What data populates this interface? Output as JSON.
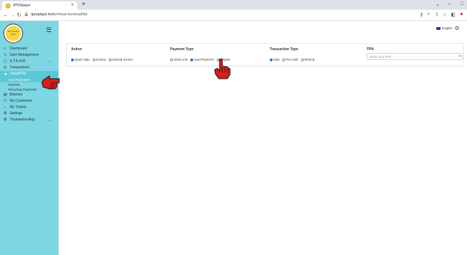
{
  "browser": {
    "tab_title": "iPOSpays",
    "new_tab": "+",
    "close_tab": "×",
    "url_host": "iposplays.tech",
    "url_path": "/virtual-terminal/list",
    "window_controls": [
      "⌄",
      "–",
      "□"
    ],
    "toolbar_icons": [
      "key-icon",
      "zoom-icon",
      "share-icon",
      "star-icon",
      "sidebar-icon"
    ]
  },
  "sidebar": {
    "logo_text": "Dve Lincoln Store",
    "menu": [
      {
        "label": "Dashboard",
        "icon": "⌂",
        "icon_name": "dashboard-icon",
        "chevron": false,
        "active": false
      },
      {
        "label": "User Management",
        "icon": "⚇",
        "icon_name": "users-icon",
        "chevron": false,
        "active": false
      },
      {
        "label": "S.T.E.A.M",
        "icon": "▢",
        "icon_name": "steam-icon",
        "chevron": true,
        "active": false
      },
      {
        "label": "Transactions",
        "icon": "◎",
        "icon_name": "transactions-icon",
        "chevron": false,
        "active": false
      },
      {
        "label": "CloudPOS",
        "icon": "☁",
        "icon_name": "cloud-icon",
        "chevron": false,
        "active": true
      }
    ],
    "submenu": [
      {
        "label": "Card Payments",
        "active": true
      },
      {
        "label": "Invoices",
        "active": false
      },
      {
        "label": "Recurring Payments",
        "active": false
      }
    ],
    "menu_bottom": [
      {
        "label": "Batches",
        "icon": "▤",
        "icon_name": "batches-icon",
        "chevron": false
      },
      {
        "label": "My Customers",
        "icon": "⚇",
        "icon_name": "customers-icon",
        "chevron": false
      },
      {
        "label": "My Tickets",
        "icon": "◌",
        "icon_name": "tickets-icon",
        "chevron": false
      },
      {
        "label": "Settings",
        "icon": "⚙",
        "icon_name": "settings-icon",
        "chevron": false
      },
      {
        "label": "Troubleshooting",
        "icon": "⚙",
        "icon_name": "troubleshooting-icon",
        "chevron": true
      }
    ]
  },
  "header": {
    "language": "English"
  },
  "form": {
    "action": {
      "title": "Action",
      "options": [
        {
          "label": "Quick Sale",
          "selected": true
        },
        {
          "label": "Invoice",
          "selected": false
        },
        {
          "label": "Upload Invoice",
          "selected": false
        }
      ]
    },
    "payment_type": {
      "title": "Payment Type",
      "options": [
        {
          "label": "Send Link",
          "selected": false
        },
        {
          "label": "Card Payment",
          "selected": true
        },
        {
          "label": "Pinpad",
          "selected": false
        }
      ]
    },
    "transaction_type": {
      "title": "Transaction Type",
      "options": [
        {
          "label": "Sale",
          "selected": true
        },
        {
          "label": "Pre-Auth",
          "selected": false
        },
        {
          "label": "Refund",
          "selected": false
        }
      ]
    },
    "tpn": {
      "title": "TPN",
      "placeholder": "Select any TPN"
    }
  },
  "colors": {
    "sidebar_bg": "#7dd6e2",
    "accent": "#1a78d4",
    "pointer": "#d61f1f"
  }
}
